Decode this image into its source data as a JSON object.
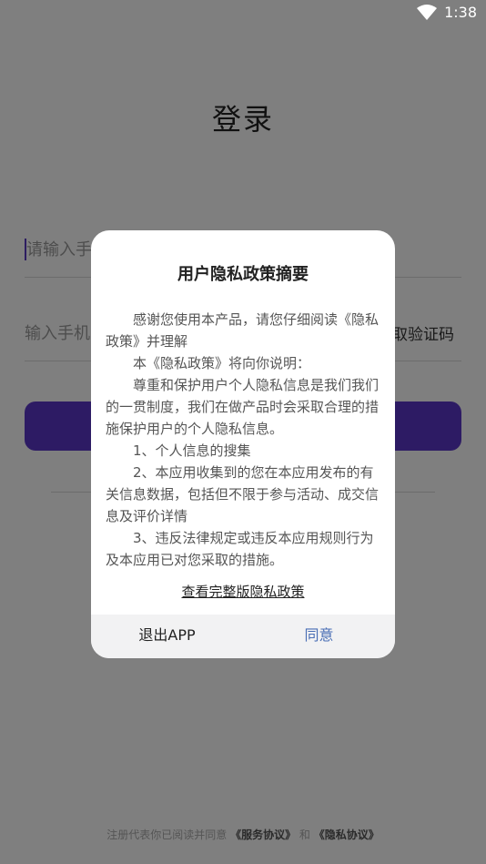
{
  "status": {
    "time": "1:38"
  },
  "login": {
    "title": "登录",
    "phone_placeholder": "请输入手",
    "code_placeholder": "输入手机",
    "code_button": "取验证码"
  },
  "agreement": {
    "prefix": "注册代表你已阅读并同意",
    "service": "《服务协议》",
    "and": "和",
    "privacy": "《隐私协议》"
  },
  "dialog": {
    "title": "用户隐私政策摘要",
    "paragraphs": [
      "感谢您使用本产品，请您仔细阅读《隐私 政策》并理解",
      "本《隐私政策》将向你说明：",
      "尊重和保护用户个人隐私信息是我们我们的一贯制度，我们在做产品时会采取合理的措施保护用户的个人隐私信息。",
      "1、个人信息的搜集",
      "2、本应用收集到的您在本应用发布的有关信息数据，包括但不限于参与活动、成交信息及评价详情",
      "3、违反法律规定或违反本应用规则行为及本应用已对您采取的措施。"
    ],
    "full_policy_link": "查看完整版隐私政策",
    "exit_label": "退出APP",
    "agree_label": "同意"
  }
}
